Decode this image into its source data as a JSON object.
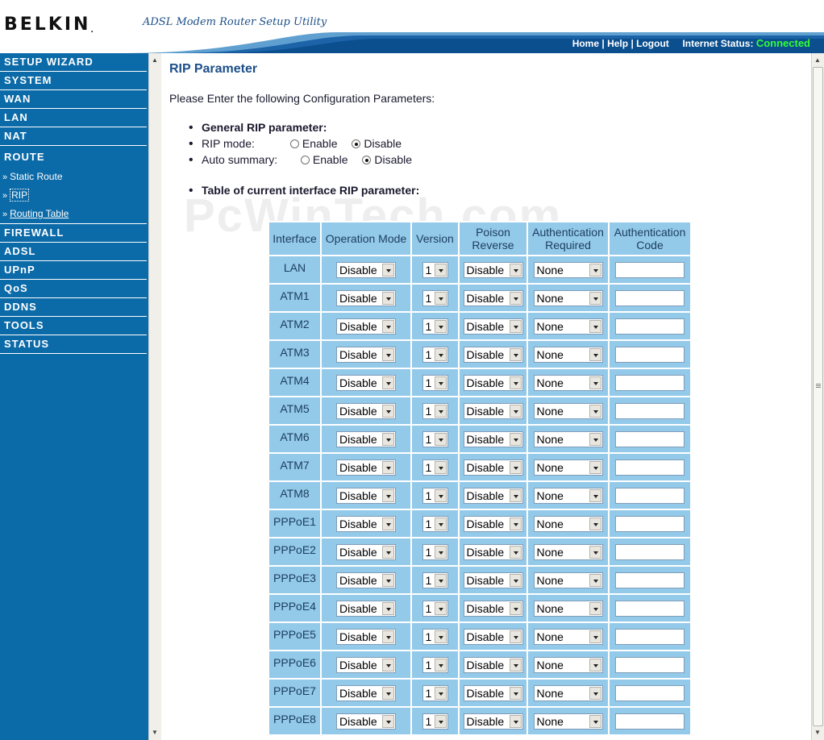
{
  "header": {
    "brand": "BELKIN",
    "brand_mark": ".",
    "subtitle": "ADSL Modem Router Setup Utility",
    "links": {
      "home": "Home",
      "sep": "|",
      "help": "Help",
      "logout": "Logout"
    },
    "status_label": "Internet Status:",
    "status_value": "Connected",
    "colors": {
      "brand_blue": "#1c4f88",
      "nav_blue": "#0b6aa8",
      "status_green": "#33ff33",
      "table_cell": "#93c9e9"
    }
  },
  "sidebar": {
    "items": [
      {
        "label": "SETUP WIZARD"
      },
      {
        "label": "SYSTEM"
      },
      {
        "label": "WAN"
      },
      {
        "label": "LAN"
      },
      {
        "label": "NAT"
      },
      {
        "label": "ROUTE"
      },
      {
        "label": "FIREWALL"
      },
      {
        "label": "ADSL"
      },
      {
        "label": "UPnP"
      },
      {
        "label": "QoS"
      },
      {
        "label": "DDNS"
      },
      {
        "label": "TOOLS"
      },
      {
        "label": "STATUS"
      }
    ],
    "route_sub": [
      {
        "label": "Static Route",
        "arrow": "»"
      },
      {
        "label": "RIP",
        "arrow": "»"
      },
      {
        "label": "Routing Table",
        "arrow": "»"
      }
    ]
  },
  "main": {
    "title": "RIP Parameter",
    "intro": "Please Enter the following Configuration Parameters:",
    "general_heading": "General RIP parameter:",
    "rip_mode": {
      "label": "RIP mode:",
      "enable": "Enable",
      "disable": "Disable",
      "selected": "Disable"
    },
    "auto_summary": {
      "label": "Auto summary:",
      "enable": "Enable",
      "disable": "Disable",
      "selected": "Disable"
    },
    "table_heading": "Table of current interface RIP parameter:",
    "watermark": "PcWinTech.com"
  },
  "table": {
    "headers": {
      "interface": "Interface",
      "operation_mode": "Operation Mode",
      "version": "Version",
      "poison_reverse_1": "Poison",
      "poison_reverse_2": "Reverse",
      "auth_required_1": "Authentication",
      "auth_required_2": "Required",
      "auth_code_1": "Authentication",
      "auth_code_2": "Code"
    },
    "rows": [
      {
        "name": "LAN",
        "mode": "Disable",
        "version": "1",
        "poison": "Disable",
        "auth": "None",
        "code": ""
      },
      {
        "name": "ATM1",
        "mode": "Disable",
        "version": "1",
        "poison": "Disable",
        "auth": "None",
        "code": ""
      },
      {
        "name": "ATM2",
        "mode": "Disable",
        "version": "1",
        "poison": "Disable",
        "auth": "None",
        "code": ""
      },
      {
        "name": "ATM3",
        "mode": "Disable",
        "version": "1",
        "poison": "Disable",
        "auth": "None",
        "code": ""
      },
      {
        "name": "ATM4",
        "mode": "Disable",
        "version": "1",
        "poison": "Disable",
        "auth": "None",
        "code": ""
      },
      {
        "name": "ATM5",
        "mode": "Disable",
        "version": "1",
        "poison": "Disable",
        "auth": "None",
        "code": ""
      },
      {
        "name": "ATM6",
        "mode": "Disable",
        "version": "1",
        "poison": "Disable",
        "auth": "None",
        "code": ""
      },
      {
        "name": "ATM7",
        "mode": "Disable",
        "version": "1",
        "poison": "Disable",
        "auth": "None",
        "code": ""
      },
      {
        "name": "ATM8",
        "mode": "Disable",
        "version": "1",
        "poison": "Disable",
        "auth": "None",
        "code": ""
      },
      {
        "name": "PPPoE1",
        "mode": "Disable",
        "version": "1",
        "poison": "Disable",
        "auth": "None",
        "code": ""
      },
      {
        "name": "PPPoE2",
        "mode": "Disable",
        "version": "1",
        "poison": "Disable",
        "auth": "None",
        "code": ""
      },
      {
        "name": "PPPoE3",
        "mode": "Disable",
        "version": "1",
        "poison": "Disable",
        "auth": "None",
        "code": ""
      },
      {
        "name": "PPPoE4",
        "mode": "Disable",
        "version": "1",
        "poison": "Disable",
        "auth": "None",
        "code": ""
      },
      {
        "name": "PPPoE5",
        "mode": "Disable",
        "version": "1",
        "poison": "Disable",
        "auth": "None",
        "code": ""
      },
      {
        "name": "PPPoE6",
        "mode": "Disable",
        "version": "1",
        "poison": "Disable",
        "auth": "None",
        "code": ""
      },
      {
        "name": "PPPoE7",
        "mode": "Disable",
        "version": "1",
        "poison": "Disable",
        "auth": "None",
        "code": ""
      },
      {
        "name": "PPPoE8",
        "mode": "Disable",
        "version": "1",
        "poison": "Disable",
        "auth": "None",
        "code": ""
      }
    ]
  }
}
